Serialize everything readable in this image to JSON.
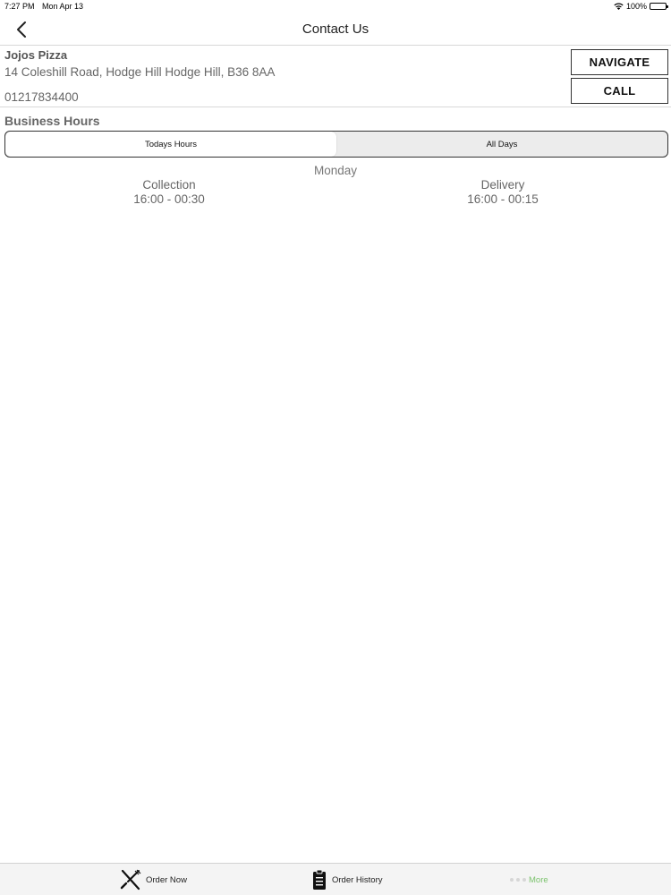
{
  "status_bar": {
    "time": "7:27 PM",
    "date": "Mon Apr 13",
    "battery": "100%"
  },
  "nav": {
    "title": "Contact Us",
    "back_icon": "chevron-left-icon"
  },
  "store": {
    "name": "Jojos Pizza",
    "address": "14 Coleshill Road, Hodge Hill Hodge Hill, B36 8AA",
    "phone": "01217834400",
    "navigate_label": "NAVIGATE",
    "call_label": "CALL"
  },
  "hours": {
    "title": "Business Hours",
    "tabs": [
      {
        "label": "Todays Hours",
        "active": true
      },
      {
        "label": "All Days",
        "active": false
      }
    ],
    "day": "Monday",
    "collection_label": "Collection",
    "collection_time": "16:00 - 00:30",
    "delivery_label": "Delivery",
    "delivery_time": "16:00 - 00:15"
  },
  "tab_bar": {
    "items": [
      {
        "label": "Order Now",
        "icon": "fork-knife-icon"
      },
      {
        "label": "Order History",
        "icon": "clipboard-icon"
      },
      {
        "label": "More",
        "icon": "more-dots-icon"
      }
    ],
    "active_color": "#7cc36e"
  }
}
